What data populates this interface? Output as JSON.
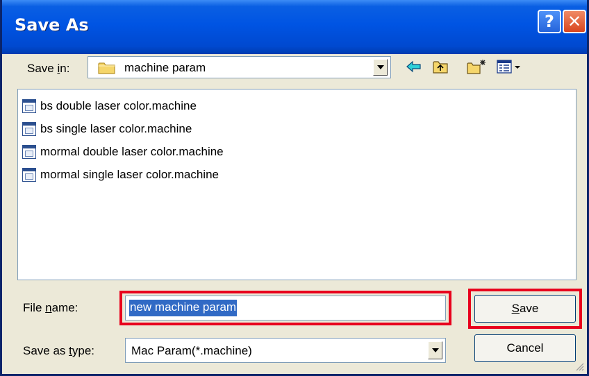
{
  "title": "Save As",
  "titlebar_buttons": {
    "help": "?",
    "close": "✕"
  },
  "save_in": {
    "label_before": "Save ",
    "label_mnemonic": "i",
    "label_after": "n:",
    "value": "machine param"
  },
  "toolbar_icons": [
    "back-icon",
    "up-folder-icon",
    "new-folder-icon",
    "view-menu-icon"
  ],
  "files": [
    {
      "name": "bs double laser color.machine"
    },
    {
      "name": "bs single laser color.machine"
    },
    {
      "name": "mormal double laser color.machine"
    },
    {
      "name": "mormal single laser color.machine"
    }
  ],
  "file_name": {
    "label_before": "File ",
    "label_mnemonic": "n",
    "label_after": "ame:",
    "value": "new machine param"
  },
  "save_as_type": {
    "label_before": "Save as ",
    "label_mnemonic": "t",
    "label_after": "ype:",
    "value": "Mac Param(*.machine)"
  },
  "buttons": {
    "save_mnemonic": "S",
    "save_rest": "ave",
    "cancel": "Cancel"
  },
  "colors": {
    "title_bar": "#0054e3",
    "highlight": "#e8001c",
    "selection": "#316ac5"
  }
}
